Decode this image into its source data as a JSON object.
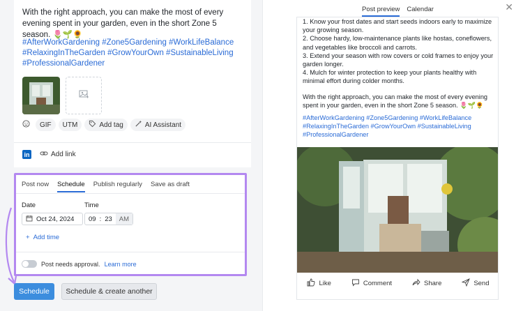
{
  "editor": {
    "post_text": "With the right approach, you can make the most of every evening spent in your garden, even in the short Zone 5 season. 🌷🌱🌻",
    "hashtags": "#AfterWorkGardening #Zone5Gardening #WorkLifeBalance #RelaxingInTheGarden #GrowYourOwn #SustainableLiving #ProfessionalGardener",
    "toolbar": [
      "GIF",
      "UTM",
      "Add tag",
      "AI Assistant"
    ],
    "add_link": "Add link"
  },
  "schedule": {
    "tabs": [
      "Post now",
      "Schedule",
      "Publish regularly",
      "Save as draft"
    ],
    "active_tab": "Schedule",
    "date_label": "Date",
    "date_value": "Oct 24, 2024",
    "time_label": "Time",
    "time_hour": "09",
    "time_minute": "23",
    "time_ampm": "AM",
    "add_time": "Add time",
    "approval_text": "Post needs approval.",
    "learn_more": "Learn more"
  },
  "buttons": {
    "schedule": "Schedule",
    "schedule_another": "Schedule & create another"
  },
  "preview": {
    "tabs": [
      "Post preview",
      "Calendar"
    ],
    "active_tab": "Post preview",
    "lines": [
      "1. Know your frost dates and start seeds indoors early to maximize your growing season.",
      "2. Choose hardy, low-maintenance plants like hostas, coneflowers, and vegetables like broccoli and carrots.",
      "3. Extend your season with row covers or cold frames to enjoy your garden longer.",
      "4. Mulch for winter protection to keep your plants healthy with minimal effort during colder months."
    ],
    "closing": "With the right approach, you can make the most of every evening spent in your garden, even in the short Zone 5 season. 🌷🌱🌻",
    "hashtags": "#AfterWorkGardening #Zone5Gardening #WorkLifeBalance #RelaxingInTheGarden #GrowYourOwn #SustainableLiving #ProfessionalGardener",
    "actions": [
      "Like",
      "Comment",
      "Share",
      "Send"
    ]
  },
  "colors": {
    "accent": "#2a6bd6",
    "highlight_border": "#b388f0",
    "primary_button": "#3c8dde",
    "linkedin": "#0a66c2"
  }
}
